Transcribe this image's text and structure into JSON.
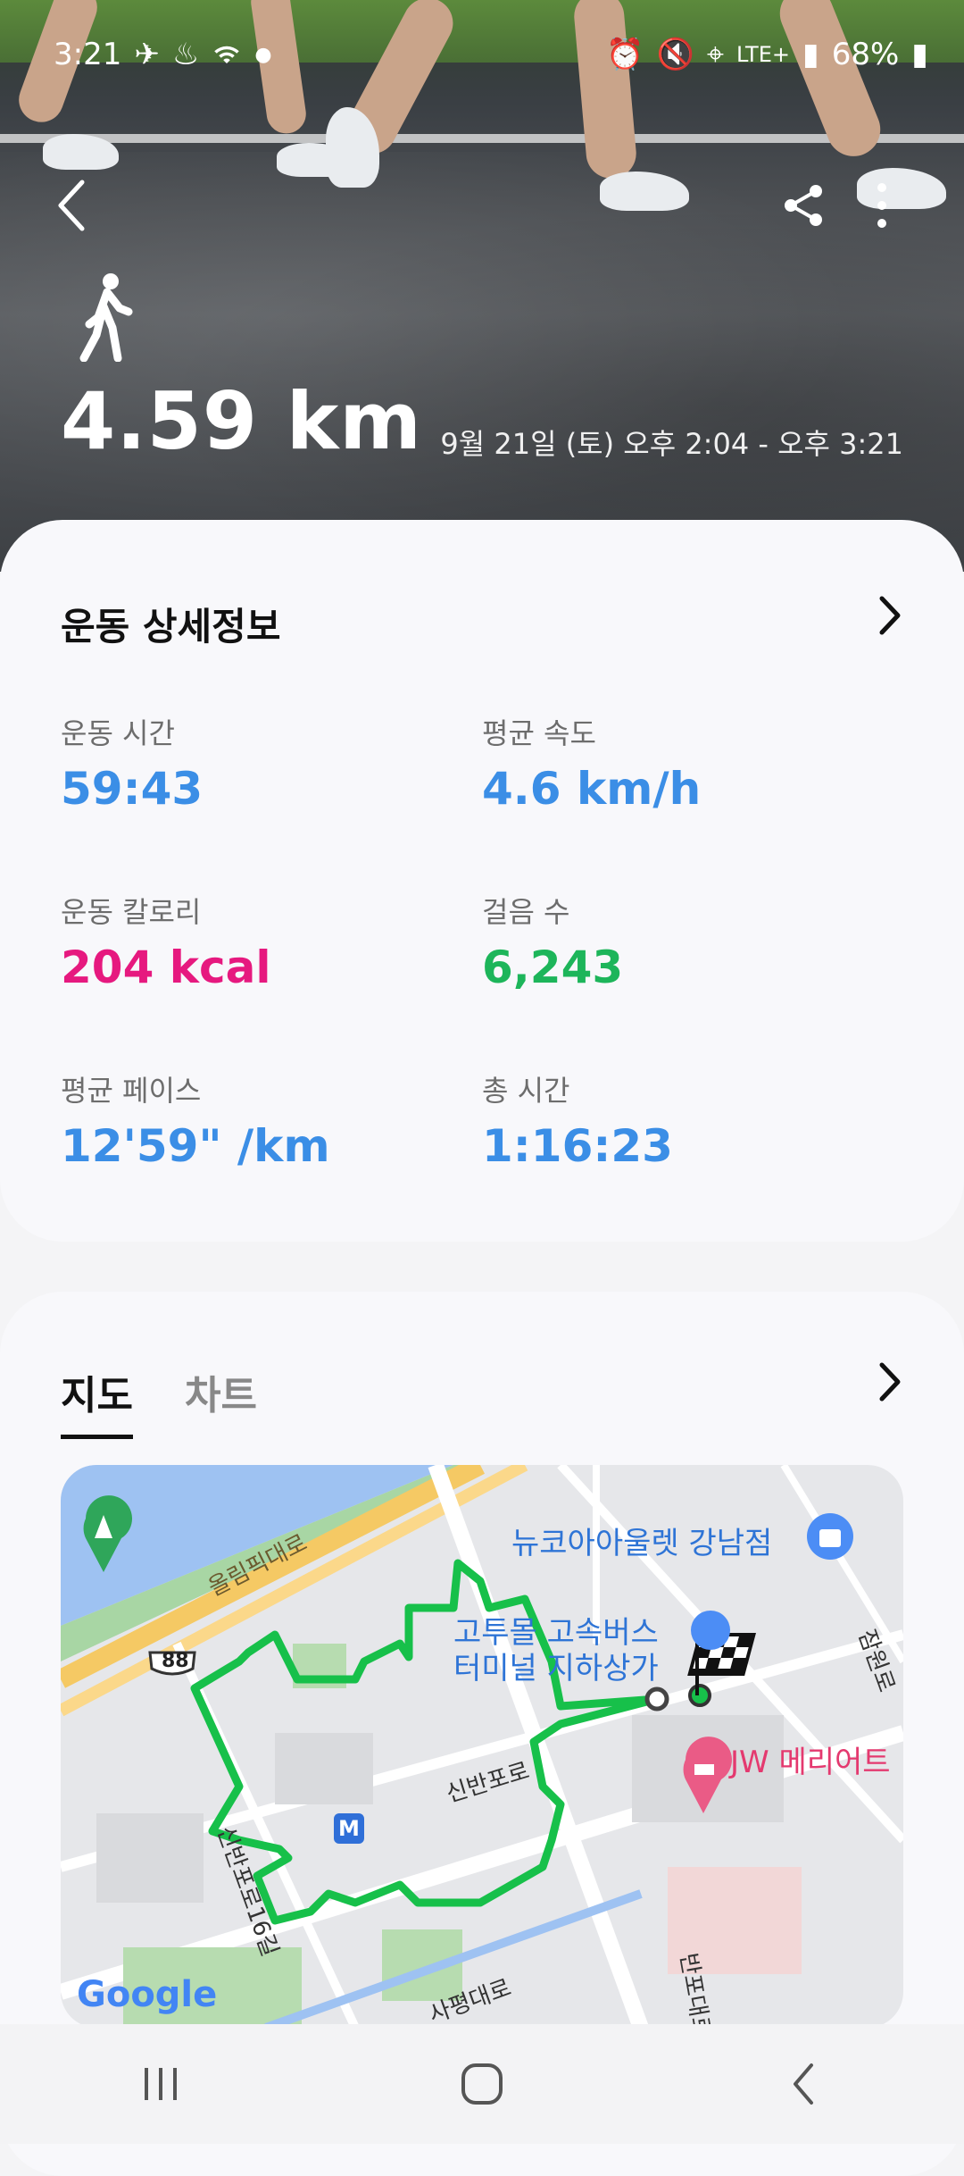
{
  "status_bar": {
    "time": "3:21",
    "network": "LTE+",
    "battery": "68%"
  },
  "header": {
    "back_icon": "chevron-left-icon",
    "share_icon": "share-icon",
    "more_icon": "more-vertical-icon",
    "activity_icon": "walking-person-icon",
    "distance": "4.59 km",
    "datetime": "9월 21일 (토) 오후 2:04 - 오후 3:21"
  },
  "details": {
    "title": "운동 상세정보",
    "stats": [
      {
        "label": "운동 시간",
        "value": "59:43",
        "color": "#3b8ee6"
      },
      {
        "label": "평균 속도",
        "value": "4.6 km/h",
        "color": "#3b8ee6"
      },
      {
        "label": "운동 칼로리",
        "value": "204 kcal",
        "color": "#e6197f"
      },
      {
        "label": "걸음 수",
        "value": "6,243",
        "color": "#1db55a"
      },
      {
        "label": "평균 페이스",
        "value": "12'59\" /km",
        "color": "#3b8ee6"
      },
      {
        "label": "총 시간",
        "value": "1:16:23",
        "color": "#3b8ee6"
      }
    ]
  },
  "map_section": {
    "tabs": [
      {
        "label": "지도",
        "active": true
      },
      {
        "label": "차트",
        "active": false
      }
    ],
    "map_labels": {
      "olympic_road": "올림픽대로",
      "route_88": "88",
      "newcore": "뉴코아아울렛 강남점",
      "goto_mall_1": "고투몰 고속버스",
      "goto_mall_2": "터미널 지하상가",
      "jw": "JW 메리어트",
      "sinbanpo": "신반포로",
      "sinbanpo16": "신반포로16길",
      "sapyeong": "사평대로",
      "banpo": "반포대로",
      "jamwon": "잠원로",
      "metro": "M",
      "google": "Google"
    }
  },
  "nav": {
    "recents_icon": "recents-icon",
    "home_icon": "home-icon",
    "back_icon": "back-icon"
  }
}
